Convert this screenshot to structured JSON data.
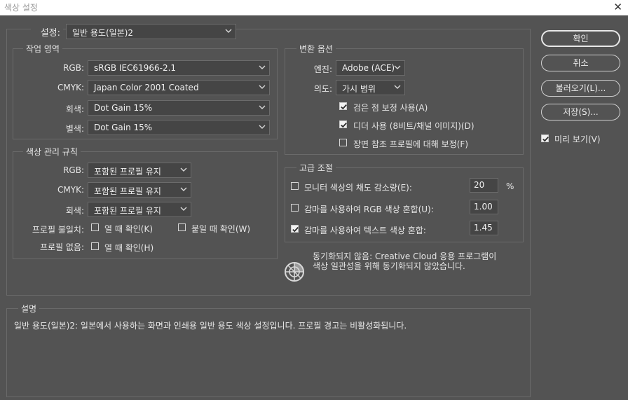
{
  "window": {
    "title": "색상 설정",
    "close_glyph": "✕"
  },
  "settings": {
    "label": "설정:",
    "value": "일반 용도(일본)2"
  },
  "working_spaces": {
    "title": "작업 영역",
    "rgb": {
      "label": "RGB:",
      "value": "sRGB IEC61966-2.1"
    },
    "cmyk": {
      "label": "CMYK:",
      "value": "Japan Color 2001 Coated"
    },
    "gray": {
      "label": "회색:",
      "value": "Dot Gain 15%"
    },
    "spot": {
      "label": "별색:",
      "value": "Dot Gain 15%"
    }
  },
  "color_management": {
    "title": "색상 관리 규칙",
    "rgb": {
      "label": "RGB:",
      "value": "포함된 프로필 유지"
    },
    "cmyk": {
      "label": "CMYK:",
      "value": "포함된 프로필 유지"
    },
    "gray": {
      "label": "회색:",
      "value": "포함된 프로필 유지"
    },
    "mismatch_label": "프로필 불일치:",
    "ask_open": {
      "label": "열 때 확인(K)",
      "checked": false
    },
    "ask_paste": {
      "label": "붙일 때 확인(W)",
      "checked": false
    },
    "missing_label": "프로필 없음:",
    "missing_ask_open": {
      "label": "열 때 확인(H)",
      "checked": false
    }
  },
  "conversion": {
    "title": "변환 옵션",
    "engine": {
      "label": "엔진:",
      "value": "Adobe (ACE)"
    },
    "intent": {
      "label": "의도:",
      "value": "가시 범위"
    },
    "black_point": {
      "label": "검은 점 보정 사용(A)",
      "checked": true
    },
    "dither": {
      "label": "디더 사용 (8비트/채널 이미지)(D)",
      "checked": true
    },
    "scene_ref": {
      "label": "장면 참조 프로필에 대해 보정(F)",
      "checked": false
    }
  },
  "advanced": {
    "title": "고급 조절",
    "desaturate": {
      "label": "모니터 색상의 채도 감소량(E):",
      "checked": false,
      "value": "20",
      "unit": "%"
    },
    "blend_rgb": {
      "label": "감마를 사용하여 RGB 색상 혼합(U):",
      "checked": false,
      "value": "1.00"
    },
    "blend_text": {
      "label": "감마를 사용하여 텍스트 색상 혼합:",
      "checked": true,
      "value": "1.45"
    }
  },
  "sync": {
    "icon": "sync-status-icon",
    "line1": "동기화되지 않음: Creative Cloud 응용 프로그램이",
    "line2": "색상 일관성을 위해 동기화되지 않았습니다."
  },
  "description": {
    "title": "설명",
    "text": "일반 용도(일본)2: 일본에서 사용하는 화면과 인쇄용 일반 용도 색상 설정입니다. 프로필 경고는 비활성화됩니다."
  },
  "buttons": {
    "ok": "확인",
    "cancel": "취소",
    "load": "불러오기(L)...",
    "save": "저장(S)..."
  },
  "preview": {
    "label": "미리 보기(V)",
    "checked": true
  },
  "colors": {
    "background": "#535353",
    "field": "#454545",
    "border": "#6a6a6a",
    "text": "#e6e6e6"
  }
}
